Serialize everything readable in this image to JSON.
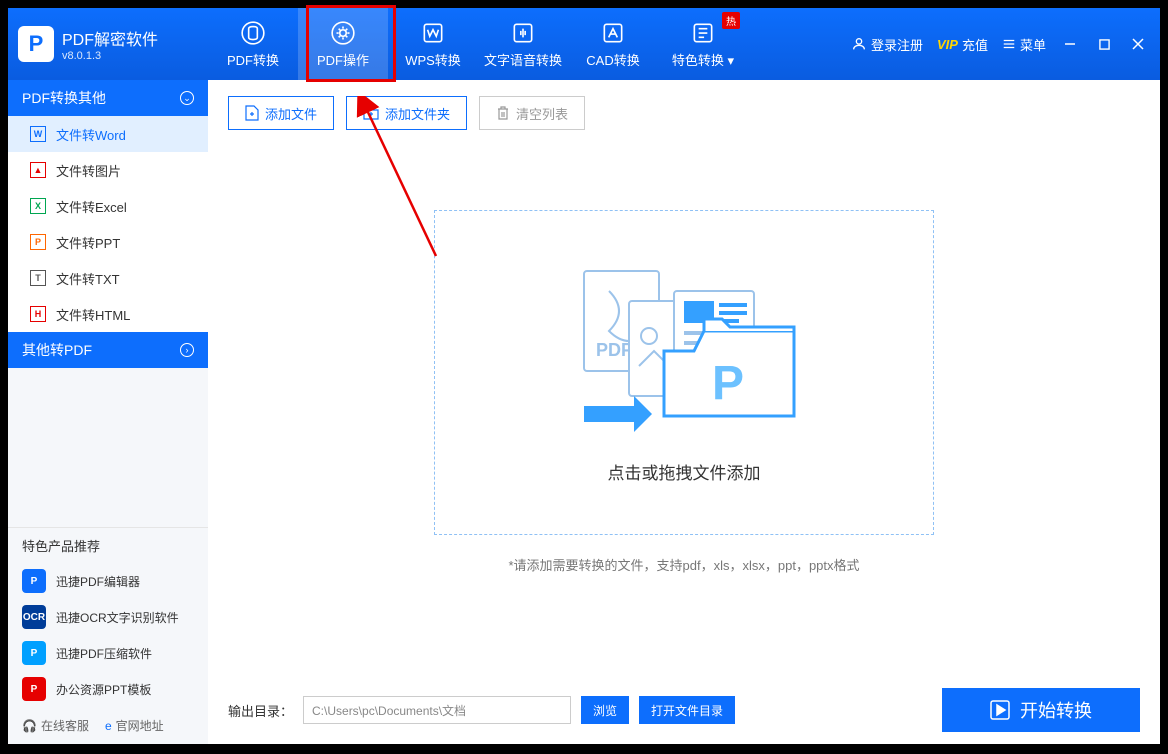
{
  "app": {
    "title": "PDF解密软件",
    "version": "v8.0.1.3"
  },
  "nav": {
    "tabs": [
      {
        "label": "PDF转换"
      },
      {
        "label": "PDF操作"
      },
      {
        "label": "WPS转换"
      },
      {
        "label": "文字语音转换"
      },
      {
        "label": "CAD转换"
      },
      {
        "label": "特色转换"
      }
    ],
    "hot_badge": "热"
  },
  "top_right": {
    "login": "登录注册",
    "vip_prefix": "VIP",
    "vip_label": "充值",
    "menu": "菜单"
  },
  "sidebar": {
    "cat1": "PDF转换其他",
    "items": [
      {
        "label": "文件转Word"
      },
      {
        "label": "文件转图片"
      },
      {
        "label": "文件转Excel"
      },
      {
        "label": "文件转PPT"
      },
      {
        "label": "文件转TXT"
      },
      {
        "label": "文件转HTML"
      }
    ],
    "cat2": "其他转PDF",
    "promo_title": "特色产品推荐",
    "promos": [
      {
        "label": "迅捷PDF编辑器",
        "color": "#0d6efd",
        "tag": "P"
      },
      {
        "label": "迅捷OCR文字识别软件",
        "color": "#003d99",
        "tag": "OCR"
      },
      {
        "label": "迅捷PDF压缩软件",
        "color": "#00a0ff",
        "tag": "P"
      },
      {
        "label": "办公资源PPT模板",
        "color": "#e60000",
        "tag": "P"
      }
    ],
    "footer": {
      "service": "在线客服",
      "website": "官网地址"
    }
  },
  "main": {
    "add_file": "添加文件",
    "add_folder": "添加文件夹",
    "clear_list": "清空列表",
    "drop_text": "点击或拖拽文件添加",
    "drop_hint": "*请添加需要转换的文件，支持pdf，xls，xlsx，ppt，pptx格式",
    "output_label": "输出目录：",
    "output_path": "C:\\Users\\pc\\Documents\\文档",
    "browse": "浏览",
    "open_dir": "打开文件目录",
    "start": "开始转换"
  }
}
